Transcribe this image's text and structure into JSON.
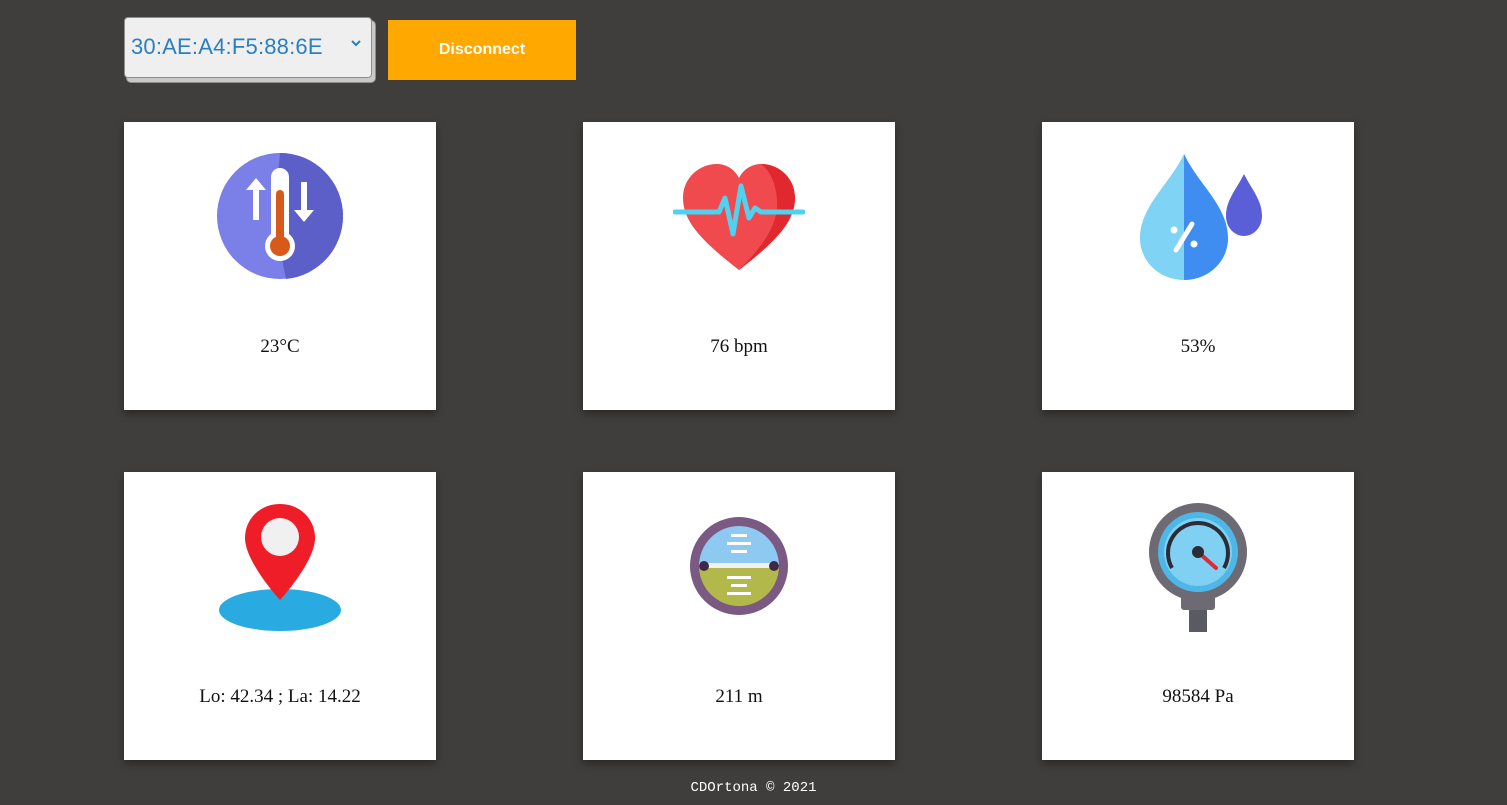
{
  "device_select": {
    "selected": "30:AE:A4:F5:88:6E"
  },
  "toolbar": {
    "disconnect_label": "Disconnect"
  },
  "colors": {
    "background": "#403e3c",
    "accent": "#ffa800",
    "select_text": "#2a7fc0"
  },
  "cards": [
    {
      "icon": "thermometer-icon",
      "value": "23°C"
    },
    {
      "icon": "heart-rate-icon",
      "value": "76 bpm"
    },
    {
      "icon": "humidity-drops-icon",
      "value": "53%"
    },
    {
      "icon": "location-pin-icon",
      "value": "Lo: 42.34 ; La: 14.22"
    },
    {
      "icon": "altimeter-icon",
      "value": "211 m"
    },
    {
      "icon": "pressure-gauge-icon",
      "value": "98584 Pa"
    }
  ],
  "footer": {
    "text": "CDOrtona © 2021"
  }
}
